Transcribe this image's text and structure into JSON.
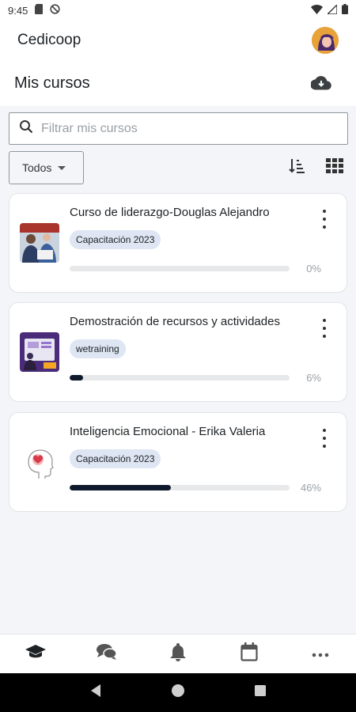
{
  "status_bar": {
    "time": "9:45"
  },
  "app": {
    "title": "Cedicoop"
  },
  "page": {
    "title": "Mis cursos"
  },
  "search": {
    "placeholder": "Filtrar mis cursos"
  },
  "filter": {
    "selected": "Todos"
  },
  "courses": [
    {
      "name": "Curso de liderazgo-Douglas Alejandro",
      "category": "Capacitación 2023",
      "progress_label": "0%",
      "progress": 0
    },
    {
      "name": "Demostración de recursos y actividades",
      "category": "wetraining",
      "progress_label": "6%",
      "progress": 6
    },
    {
      "name": "Inteligencia Emocional - Erika Valeria",
      "category": "Capacitación 2023",
      "progress_label": "46%",
      "progress": 46
    }
  ],
  "bottom_nav": [
    "mortarboard-icon",
    "chat-icon",
    "bell-icon",
    "calendar-icon",
    "more-icon"
  ],
  "colors": {
    "accent": "#0f1b2d",
    "badge": "#dde6f2",
    "background": "#f4f5f8"
  }
}
